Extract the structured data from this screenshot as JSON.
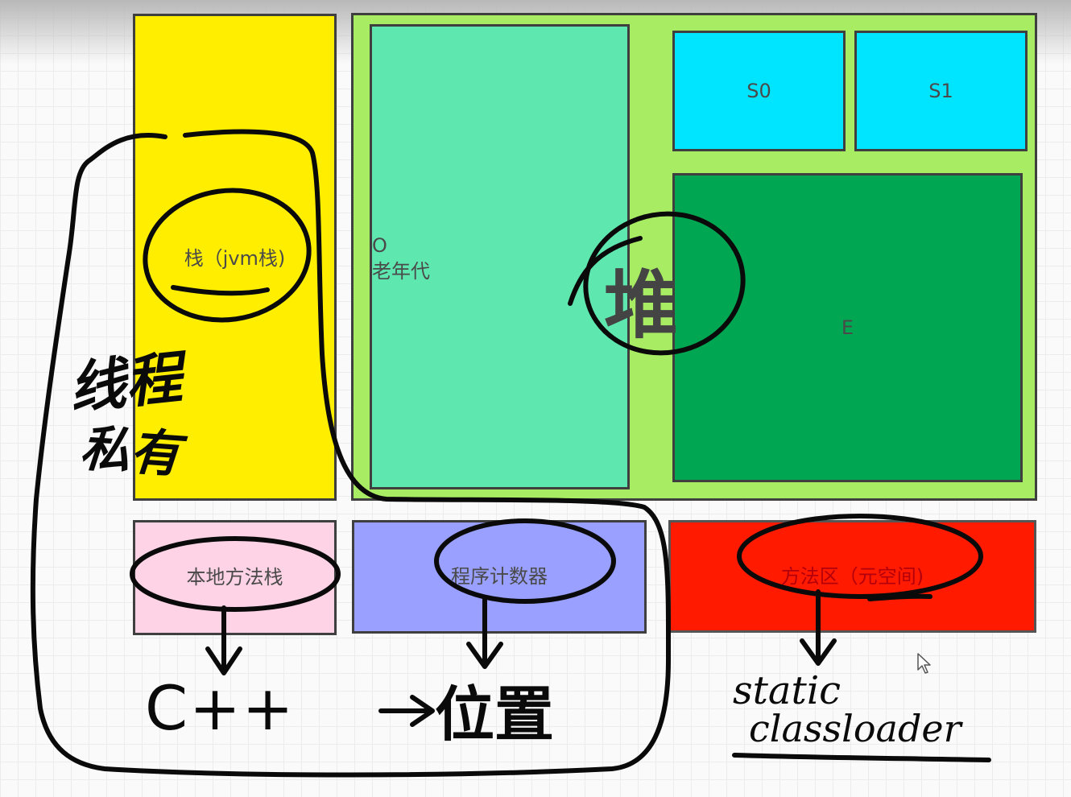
{
  "diagram": {
    "boxes": {
      "stack": {
        "label": "栈（jvm栈)",
        "color": "#ffee00"
      },
      "heap": {
        "color": "#a8ec63"
      },
      "old_gen": {
        "line1": "O",
        "line2": "老年代",
        "color": "#5ee8b0"
      },
      "survivor_0": {
        "label": "S0",
        "color": "#00e5ff"
      },
      "survivor_1": {
        "label": "S1",
        "color": "#00e5ff"
      },
      "eden": {
        "label": "E",
        "color": "#00a651"
      },
      "native_method_stack": {
        "label": "本地方法栈",
        "color": "#ffd3e6"
      },
      "program_counter": {
        "label": "程序计数器",
        "color": "#99a0ff"
      },
      "method_area": {
        "label": "方法区（元空间)",
        "color": "#ff1a00"
      }
    },
    "annotations": {
      "heap_char": "堆",
      "thread_private_line1": "线程",
      "thread_private_line2": "私有",
      "cpp": "C++",
      "position": "位置",
      "static": "static",
      "classloader": "classloader"
    }
  }
}
